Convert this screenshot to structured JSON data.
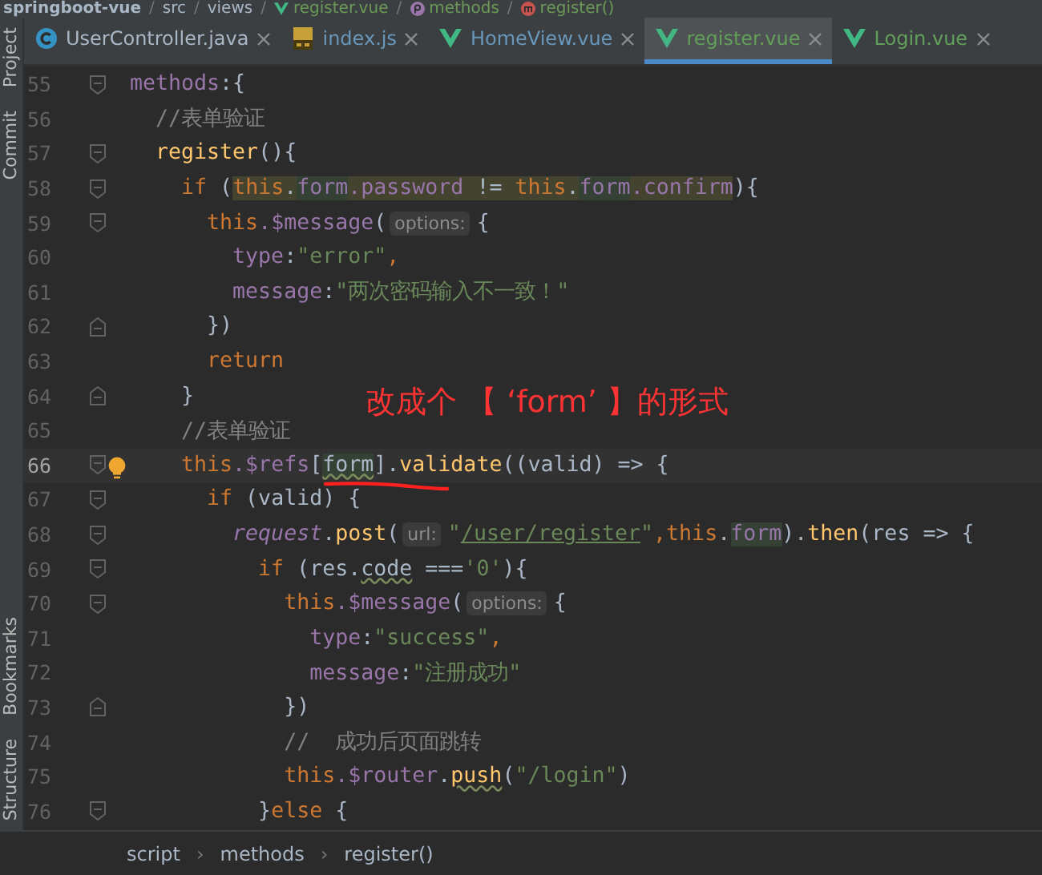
{
  "path_bar": {
    "items": [
      {
        "text": "springboot-vue",
        "kind": "project"
      },
      {
        "text": "src",
        "kind": "folder"
      },
      {
        "text": "views",
        "kind": "folder"
      },
      {
        "text": "register.vue",
        "kind": "vue"
      },
      {
        "text": "methods",
        "kind": "property"
      },
      {
        "text": "register()",
        "kind": "method"
      }
    ],
    "separator": "/"
  },
  "tabs": [
    {
      "label": "UserController.java",
      "kind": "java",
      "color": "#a9b7c6",
      "selected": false
    },
    {
      "label": "index.js",
      "kind": "js",
      "color": "#6897bb",
      "selected": false
    },
    {
      "label": "HomeView.vue",
      "kind": "vue",
      "color": "#6897bb",
      "selected": false
    },
    {
      "label": "register.vue",
      "kind": "vue",
      "color": "#62a05a",
      "selected": true
    },
    {
      "label": "Login.vue",
      "kind": "vue",
      "color": "#62a05a",
      "selected": false
    }
  ],
  "side_strip": {
    "top": [
      "Project",
      "Commit"
    ],
    "bottom": [
      "Bookmarks",
      "Structure"
    ]
  },
  "editor": {
    "lines": [
      {
        "number": "55",
        "fold_start": true,
        "fold_end": false,
        "current": false,
        "bulb": false,
        "segments": [
          {
            "kind": "code",
            "tokens": [
              {
                "t": "methods",
                "color": "#9876aa"
              },
              {
                "t": ":{"
              }
            ]
          }
        ]
      },
      {
        "number": "56",
        "fold_start": false,
        "fold_end": false,
        "current": false,
        "bulb": false,
        "segments": [
          {
            "kind": "code",
            "tokens": [
              {
                "t": "  //表单验证",
                "color": "#808080"
              }
            ]
          }
        ]
      },
      {
        "number": "57",
        "fold_start": true,
        "fold_end": false,
        "current": false,
        "bulb": false,
        "segments": [
          {
            "kind": "code",
            "tokens": [
              {
                "t": "  register",
                "color": "#ffc66d"
              },
              {
                "t": "(){"
              }
            ]
          }
        ]
      },
      {
        "number": "58",
        "fold_start": true,
        "fold_end": false,
        "current": false,
        "bulb": false,
        "segments": [
          {
            "kind": "code",
            "tokens": [
              {
                "t": "    if",
                "color": "#cc7832"
              },
              {
                "t": " ("
              },
              {
                "t": "this",
                "color": "#cc7832",
                "read_access": true
              },
              {
                "t": ".",
                "read_access": true
              },
              {
                "t": "form",
                "color": "#9876aa",
                "occurrence": true
              },
              {
                "t": ".password",
                "color": "#9876aa",
                "read_access": true
              },
              {
                "t": " != ",
                "read_access": true
              },
              {
                "t": "this",
                "color": "#cc7832",
                "read_access": true
              },
              {
                "t": ".",
                "read_access": true
              },
              {
                "t": "form",
                "color": "#9876aa",
                "occurrence": true
              },
              {
                "t": ".confirm",
                "color": "#9876aa",
                "read_access": true
              },
              {
                "t": "){"
              }
            ]
          }
        ]
      },
      {
        "number": "59",
        "fold_start": true,
        "fold_end": false,
        "current": false,
        "bulb": false,
        "segments": [
          {
            "kind": "code",
            "tokens": [
              {
                "t": "      this",
                "color": "#cc7832"
              },
              {
                "t": ".$message",
                "color": "#9876aa"
              },
              {
                "t": "("
              }
            ]
          },
          {
            "kind": "hint",
            "text": "options:"
          },
          {
            "kind": "code",
            "tokens": [
              {
                "t": "{"
              }
            ]
          }
        ]
      },
      {
        "number": "60",
        "fold_start": false,
        "fold_end": false,
        "current": false,
        "bulb": false,
        "segments": [
          {
            "kind": "code",
            "tokens": [
              {
                "t": "        type",
                "color": "#9876aa"
              },
              {
                "t": ":"
              },
              {
                "t": "\"error\"",
                "color": "#6a8759"
              },
              {
                "t": ",",
                "color": "#cc7832"
              }
            ]
          }
        ]
      },
      {
        "number": "61",
        "fold_start": false,
        "fold_end": false,
        "current": false,
        "bulb": false,
        "segments": [
          {
            "kind": "code",
            "tokens": [
              {
                "t": "        message",
                "color": "#9876aa"
              },
              {
                "t": ":"
              },
              {
                "t": "\"两次密码输入不一致！\"",
                "color": "#6a8759"
              }
            ]
          }
        ]
      },
      {
        "number": "62",
        "fold_start": false,
        "fold_end": true,
        "current": false,
        "bulb": false,
        "segments": [
          {
            "kind": "code",
            "tokens": [
              {
                "t": "      })"
              }
            ]
          }
        ]
      },
      {
        "number": "63",
        "fold_start": false,
        "fold_end": false,
        "current": false,
        "bulb": false,
        "segments": [
          {
            "kind": "code",
            "tokens": [
              {
                "t": "      return",
                "color": "#cc7832"
              }
            ]
          }
        ]
      },
      {
        "number": "64",
        "fold_start": false,
        "fold_end": true,
        "current": false,
        "bulb": false,
        "segments": [
          {
            "kind": "code",
            "tokens": [
              {
                "t": "    }"
              }
            ]
          }
        ]
      },
      {
        "number": "65",
        "fold_start": false,
        "fold_end": false,
        "current": false,
        "bulb": false,
        "segments": [
          {
            "kind": "code",
            "tokens": [
              {
                "t": "    //表单验证",
                "color": "#808080"
              }
            ]
          }
        ]
      },
      {
        "number": "66",
        "fold_start": true,
        "fold_end": false,
        "current": true,
        "bulb": true,
        "segments": [
          {
            "kind": "code",
            "tokens": [
              {
                "t": "    this",
                "color": "#cc7832"
              },
              {
                "t": ".$refs",
                "color": "#9876aa"
              },
              {
                "t": "["
              },
              {
                "t": "form",
                "occurrence": true,
                "wavy": true
              },
              {
                "t": "]."
              },
              {
                "t": "validate",
                "color": "#ffc66d"
              },
              {
                "t": "((valid) => {"
              }
            ]
          }
        ]
      },
      {
        "number": "67",
        "fold_start": true,
        "fold_end": false,
        "current": false,
        "bulb": false,
        "segments": [
          {
            "kind": "code",
            "tokens": [
              {
                "t": "      if",
                "color": "#cc7832"
              },
              {
                "t": " (valid) {"
              }
            ]
          }
        ]
      },
      {
        "number": "68",
        "fold_start": true,
        "fold_end": false,
        "current": false,
        "bulb": false,
        "segments": [
          {
            "kind": "code",
            "tokens": [
              {
                "t": "        request",
                "color": "#9876aa",
                "italic": true
              },
              {
                "t": "."
              },
              {
                "t": "post",
                "color": "#ffc66d"
              },
              {
                "t": "("
              }
            ]
          },
          {
            "kind": "hint",
            "text": "url:"
          },
          {
            "kind": "code",
            "tokens": [
              {
                "t": "\"",
                "color": "#6a8759"
              },
              {
                "t": "/user/register",
                "color": "#6a8759",
                "link": true
              },
              {
                "t": "\"",
                "color": "#6a8759"
              },
              {
                "t": ",",
                "color": "#cc7832"
              },
              {
                "t": "this",
                "color": "#cc7832"
              },
              {
                "t": "."
              },
              {
                "t": "form",
                "color": "#9876aa",
                "occurrence": true
              },
              {
                "t": ")."
              },
              {
                "t": "then",
                "color": "#ffc66d"
              },
              {
                "t": "(res => {"
              }
            ]
          }
        ]
      },
      {
        "number": "69",
        "fold_start": true,
        "fold_end": false,
        "current": false,
        "bulb": false,
        "segments": [
          {
            "kind": "code",
            "tokens": [
              {
                "t": "          if",
                "color": "#cc7832"
              },
              {
                "t": " (res."
              },
              {
                "t": "code",
                "wavy": true
              },
              {
                "t": " ==="
              },
              {
                "t": "'0'",
                "color": "#6a8759"
              },
              {
                "t": "){"
              }
            ]
          }
        ]
      },
      {
        "number": "70",
        "fold_start": true,
        "fold_end": false,
        "current": false,
        "bulb": false,
        "segments": [
          {
            "kind": "code",
            "tokens": [
              {
                "t": "            this",
                "color": "#cc7832"
              },
              {
                "t": ".$message",
                "color": "#9876aa"
              },
              {
                "t": "("
              }
            ]
          },
          {
            "kind": "hint",
            "text": "options:"
          },
          {
            "kind": "code",
            "tokens": [
              {
                "t": "{"
              }
            ]
          }
        ]
      },
      {
        "number": "71",
        "fold_start": false,
        "fold_end": false,
        "current": false,
        "bulb": false,
        "segments": [
          {
            "kind": "code",
            "tokens": [
              {
                "t": "              type",
                "color": "#9876aa"
              },
              {
                "t": ":"
              },
              {
                "t": "\"success\"",
                "color": "#6a8759"
              },
              {
                "t": ",",
                "color": "#cc7832"
              }
            ]
          }
        ]
      },
      {
        "number": "72",
        "fold_start": false,
        "fold_end": false,
        "current": false,
        "bulb": false,
        "segments": [
          {
            "kind": "code",
            "tokens": [
              {
                "t": "              message",
                "color": "#9876aa"
              },
              {
                "t": ":"
              },
              {
                "t": "\"注册成功\"",
                "color": "#6a8759"
              }
            ]
          }
        ]
      },
      {
        "number": "73",
        "fold_start": false,
        "fold_end": true,
        "current": false,
        "bulb": false,
        "segments": [
          {
            "kind": "code",
            "tokens": [
              {
                "t": "            })"
              }
            ]
          }
        ]
      },
      {
        "number": "74",
        "fold_start": false,
        "fold_end": false,
        "current": false,
        "bulb": false,
        "segments": [
          {
            "kind": "code",
            "tokens": [
              {
                "t": "            //  成功后页面跳转",
                "color": "#808080"
              }
            ]
          }
        ]
      },
      {
        "number": "75",
        "fold_start": false,
        "fold_end": false,
        "current": false,
        "bulb": false,
        "segments": [
          {
            "kind": "code",
            "tokens": [
              {
                "t": "            this",
                "color": "#cc7832"
              },
              {
                "t": ".$router",
                "color": "#9876aa"
              },
              {
                "t": "."
              },
              {
                "t": "push",
                "color": "#ffc66d",
                "wavy": true
              },
              {
                "t": "("
              },
              {
                "t": "\"/login\"",
                "color": "#6a8759"
              },
              {
                "t": ")"
              }
            ]
          }
        ]
      },
      {
        "number": "76",
        "fold_start": true,
        "fold_end": false,
        "current": false,
        "bulb": false,
        "segments": [
          {
            "kind": "code",
            "tokens": [
              {
                "t": "          }"
              },
              {
                "t": "else",
                "color": "#cc7832"
              },
              {
                "t": " {"
              }
            ]
          }
        ]
      }
    ],
    "annotation": "改成个 【 ‘form’  】的形式"
  },
  "breadcrumb": {
    "items": [
      "script",
      "methods",
      "register()"
    ],
    "separator": "›"
  }
}
